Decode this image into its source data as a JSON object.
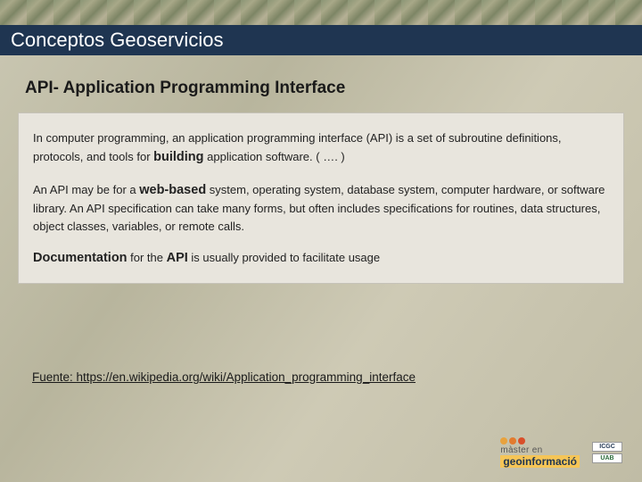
{
  "header": {
    "title": "Conceptos Geoservicios"
  },
  "subtitle": "API- Application Programming Interface",
  "content": {
    "p1_part1": "In computer programming, an application programming interface (API) is a set of subroutine definitions, protocols, and tools for ",
    "p1_bold": "building",
    "p1_part2": " application software.  ( …. )",
    "p2_part1": "An API may be for a ",
    "p2_bold": "web-based",
    "p2_part2": " system, operating system, database system, computer hardware, or software library. An API specification can take many forms, but often includes specifications for routines, data structures, object classes, variables, or remote calls.",
    "p3_bold1": "Documentation",
    "p3_mid": " for the ",
    "p3_bold2": "API",
    "p3_end": " is usually provided to facilitate usage"
  },
  "source": {
    "label": "Fuente: ",
    "url": "https://en.wikipedia.org/wiki/Application_programming_interface"
  },
  "logos": {
    "master_line1": "màster en",
    "master_line2": "geoinformació",
    "icgc": "ICGC",
    "uab": "UAB"
  }
}
